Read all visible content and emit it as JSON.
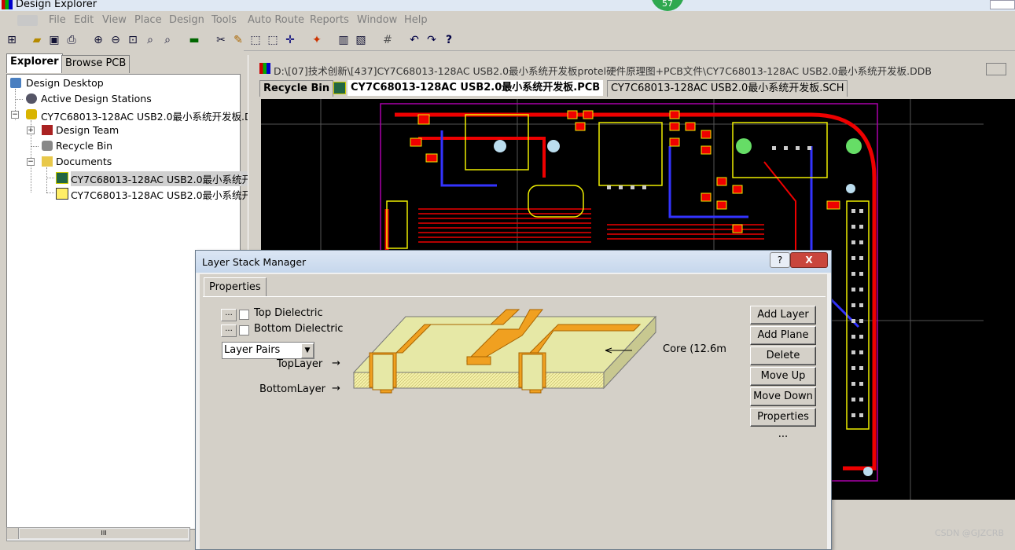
{
  "app": {
    "title": "Design Explorer"
  },
  "badge": "57",
  "menu": [
    "File",
    "Edit",
    "View",
    "Place",
    "Design",
    "Tools",
    "Auto Route",
    "Reports",
    "Window",
    "Help"
  ],
  "left_tabs": [
    "Explorer",
    "Browse PCB"
  ],
  "tree": {
    "root": "Design Desktop",
    "active_stations": "Active Design Stations",
    "project": "CY7C68013-128AC USB2.0最小系统开发板.D",
    "design_team": "Design Team",
    "recycle_bin": "Recycle Bin",
    "documents": "Documents",
    "doc1": "CY7C68013-128AC USB2.0最小系统开",
    "doc2": "CY7C68013-128AC USB2.0最小系统开"
  },
  "scroll_grip": "III",
  "doc": {
    "path": "D:\\[07]技术创新\\[437]CY7C68013-128AC USB2.0最小系统开发板protel硬件原理图+PCB文件\\CY7C68013-128AC USB2.0最小系统开发板.DDB",
    "tabs": [
      "Recycle Bin",
      "CY7C68013-128AC USB2.0最小系统开发板.PCB",
      "CY7C68013-128AC USB2.0最小系统开发板.SCH"
    ]
  },
  "dialog": {
    "title": "Layer Stack Manager",
    "help": "?",
    "close": "X",
    "tab": "Properties",
    "ellipsis": "...",
    "top_dielectric": "Top Dielectric",
    "bottom_dielectric": "Bottom Dielectric",
    "layer_mode": "Layer Pairs",
    "top_layer": "TopLayer",
    "bottom_layer": "BottomLayer",
    "core": "Core (12.6m",
    "buttons": [
      "Add Layer",
      "Add Plane",
      "Delete",
      "Move Up",
      "Move Down",
      "Properties ..."
    ]
  },
  "watermark": "CSDN @GJZCRB"
}
